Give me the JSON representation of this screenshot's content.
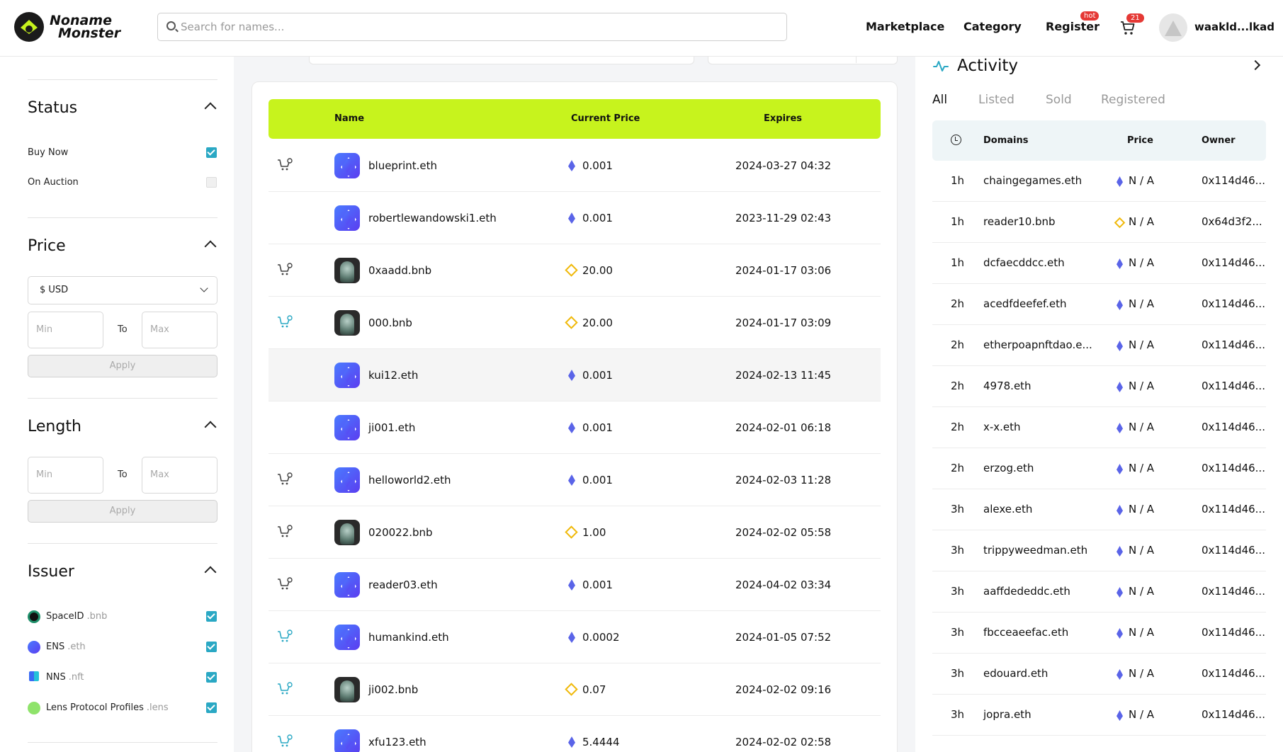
{
  "header": {
    "logo_line1": "Noname",
    "logo_line2": "Monster",
    "search_placeholder": "Search for names...",
    "nav": [
      "Marketplace",
      "Category",
      "Register"
    ],
    "hot_badge": "hot",
    "cart_count": "21",
    "username": "waakld...lkad"
  },
  "filters": {
    "status": {
      "title": "Status",
      "options": [
        {
          "label": "Buy Now",
          "checked": true
        },
        {
          "label": "On Auction",
          "checked": false
        }
      ]
    },
    "price": {
      "title": "Price",
      "currency": "$  USD",
      "min_placeholder": "Min",
      "to": "To",
      "max_placeholder": "Max",
      "apply": "Apply"
    },
    "length": {
      "title": "Length",
      "min_placeholder": "Min",
      "to": "To",
      "max_placeholder": "Max",
      "apply": "Apply"
    },
    "issuer": {
      "title": "Issuer",
      "items": [
        {
          "label": "SpaceID",
          "suffix": ".bnb",
          "checked": true
        },
        {
          "label": "ENS",
          "suffix": ".eth",
          "checked": true
        },
        {
          "label": "NNS",
          "suffix": ".nft",
          "checked": true
        },
        {
          "label": "Lens Protocol Profiles",
          "suffix": ".lens",
          "checked": true
        }
      ]
    }
  },
  "table": {
    "columns": [
      "Name",
      "Current Price",
      "Expires"
    ],
    "rows": [
      {
        "name": "blueprint.eth",
        "chain": "eth",
        "price": "0.001",
        "expires": "2024-03-27 04:32",
        "cart": "gray"
      },
      {
        "name": "robertlewandowski1.eth",
        "chain": "eth",
        "price": "0.001",
        "expires": "2023-11-29 02:43",
        "cart": "none"
      },
      {
        "name": "0xaadd.bnb",
        "chain": "bnb",
        "price": "20.00",
        "expires": "2024-01-17 03:06",
        "cart": "gray"
      },
      {
        "name": "000.bnb",
        "chain": "bnb",
        "price": "20.00",
        "expires": "2024-01-17 03:09",
        "cart": "teal"
      },
      {
        "name": "kui12.eth",
        "chain": "eth",
        "price": "0.001",
        "expires": "2024-02-13 11:45",
        "cart": "none"
      },
      {
        "name": "ji001.eth",
        "chain": "eth",
        "price": "0.001",
        "expires": "2024-02-01 06:18",
        "cart": "none"
      },
      {
        "name": "helloworld2.eth",
        "chain": "eth",
        "price": "0.001",
        "expires": "2024-02-03 11:28",
        "cart": "gray"
      },
      {
        "name": "020022.bnb",
        "chain": "bnb",
        "price": "1.00",
        "expires": "2024-02-02 05:58",
        "cart": "gray"
      },
      {
        "name": "reader03.eth",
        "chain": "eth",
        "price": "0.001",
        "expires": "2024-04-02 03:34",
        "cart": "gray"
      },
      {
        "name": "humankind.eth",
        "chain": "eth",
        "price": "0.0002",
        "expires": "2024-01-05 07:52",
        "cart": "teal"
      },
      {
        "name": "ji002.bnb",
        "chain": "bnb",
        "price": "0.07",
        "expires": "2024-02-02 09:16",
        "cart": "teal"
      },
      {
        "name": "xfu123.eth",
        "chain": "eth",
        "price": "5.4444",
        "expires": "2024-02-02 02:58",
        "cart": "teal"
      }
    ]
  },
  "activity": {
    "title": "Activity",
    "tabs": [
      "All",
      "Listed",
      "Sold",
      "Registered"
    ],
    "columns": [
      "Domains",
      "Price",
      "Owner"
    ],
    "rows": [
      {
        "time": "1h",
        "domain": "chaingegames.eth",
        "chain": "eth",
        "price": "N / A",
        "owner": "0x114d46..."
      },
      {
        "time": "1h",
        "domain": "reader10.bnb",
        "chain": "bnb",
        "price": "N / A",
        "owner": "0x64d3f2..."
      },
      {
        "time": "1h",
        "domain": "dcfaecddcc.eth",
        "chain": "eth",
        "price": "N / A",
        "owner": "0x114d46..."
      },
      {
        "time": "2h",
        "domain": "acedfdeefef.eth",
        "chain": "eth",
        "price": "N / A",
        "owner": "0x114d46..."
      },
      {
        "time": "2h",
        "domain": "etherpoapnftdao.e...",
        "chain": "eth",
        "price": "N / A",
        "owner": "0x114d46..."
      },
      {
        "time": "2h",
        "domain": "4978.eth",
        "chain": "eth",
        "price": "N / A",
        "owner": "0x114d46..."
      },
      {
        "time": "2h",
        "domain": "x-x.eth",
        "chain": "eth",
        "price": "N / A",
        "owner": "0x114d46..."
      },
      {
        "time": "2h",
        "domain": "erzog.eth",
        "chain": "eth",
        "price": "N / A",
        "owner": "0x114d46..."
      },
      {
        "time": "3h",
        "domain": "alexe.eth",
        "chain": "eth",
        "price": "N / A",
        "owner": "0x114d46..."
      },
      {
        "time": "3h",
        "domain": "trippyweedman.eth",
        "chain": "eth",
        "price": "N / A",
        "owner": "0x114d46..."
      },
      {
        "time": "3h",
        "domain": "aaffdededdc.eth",
        "chain": "eth",
        "price": "N / A",
        "owner": "0x114d46..."
      },
      {
        "time": "3h",
        "domain": "fbcceaeefac.eth",
        "chain": "eth",
        "price": "N / A",
        "owner": "0x114d46..."
      },
      {
        "time": "3h",
        "domain": "edouard.eth",
        "chain": "eth",
        "price": "N / A",
        "owner": "0x114d46..."
      },
      {
        "time": "3h",
        "domain": "jopra.eth",
        "chain": "eth",
        "price": "N / A",
        "owner": "0x114d46..."
      }
    ]
  },
  "colors": {
    "accent": "#c7f31d",
    "teal": "#2aa8c4",
    "badge_red": "#e53935",
    "eth": "#5a64e8",
    "bnb": "#f0b90b"
  }
}
